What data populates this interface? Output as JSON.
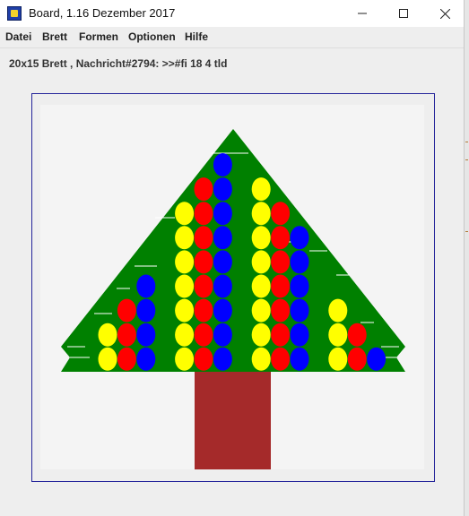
{
  "window": {
    "title": "Board, 1.16 Dezember 2017",
    "controls": {
      "minimize_icon": "minimize-icon",
      "maximize_icon": "maximize-icon",
      "close_icon": "close-icon"
    }
  },
  "menu": {
    "items": [
      {
        "label": "Datei"
      },
      {
        "label": "Brett"
      },
      {
        "label": "Formen"
      },
      {
        "label": "Optionen"
      },
      {
        "label": "Hilfe"
      }
    ]
  },
  "status": {
    "text": "20x15 Brett , Nachricht#2794: >>#fi 18 4 tld"
  },
  "board": {
    "columns": 20,
    "rows": 15,
    "colors": {
      "background": "#f4f4f4",
      "tree": "#008000",
      "trunk": "#a52a2a",
      "yellow": "#ffff00",
      "red": "#ff0000",
      "blue": "#0000ff",
      "garland": "#ffffff"
    },
    "ornaments": [
      {
        "col": 3,
        "row": 9,
        "color": "yellow"
      },
      {
        "col": 3,
        "row": 10,
        "color": "yellow"
      },
      {
        "col": 4,
        "row": 8,
        "color": "red"
      },
      {
        "col": 4,
        "row": 9,
        "color": "red"
      },
      {
        "col": 4,
        "row": 10,
        "color": "red"
      },
      {
        "col": 5,
        "row": 7,
        "color": "blue"
      },
      {
        "col": 5,
        "row": 8,
        "color": "blue"
      },
      {
        "col": 5,
        "row": 9,
        "color": "blue"
      },
      {
        "col": 5,
        "row": 10,
        "color": "blue"
      },
      {
        "col": 7,
        "row": 4,
        "color": "yellow"
      },
      {
        "col": 7,
        "row": 5,
        "color": "yellow"
      },
      {
        "col": 7,
        "row": 6,
        "color": "yellow"
      },
      {
        "col": 7,
        "row": 7,
        "color": "yellow"
      },
      {
        "col": 7,
        "row": 8,
        "color": "yellow"
      },
      {
        "col": 7,
        "row": 9,
        "color": "yellow"
      },
      {
        "col": 7,
        "row": 10,
        "color": "yellow"
      },
      {
        "col": 8,
        "row": 3,
        "color": "red"
      },
      {
        "col": 8,
        "row": 4,
        "color": "red"
      },
      {
        "col": 8,
        "row": 5,
        "color": "red"
      },
      {
        "col": 8,
        "row": 6,
        "color": "red"
      },
      {
        "col": 8,
        "row": 7,
        "color": "red"
      },
      {
        "col": 8,
        "row": 8,
        "color": "red"
      },
      {
        "col": 8,
        "row": 9,
        "color": "red"
      },
      {
        "col": 8,
        "row": 10,
        "color": "red"
      },
      {
        "col": 9,
        "row": 2,
        "color": "blue"
      },
      {
        "col": 9,
        "row": 3,
        "color": "blue"
      },
      {
        "col": 9,
        "row": 4,
        "color": "blue"
      },
      {
        "col": 9,
        "row": 5,
        "color": "blue"
      },
      {
        "col": 9,
        "row": 6,
        "color": "blue"
      },
      {
        "col": 9,
        "row": 7,
        "color": "blue"
      },
      {
        "col": 9,
        "row": 8,
        "color": "blue"
      },
      {
        "col": 9,
        "row": 9,
        "color": "blue"
      },
      {
        "col": 9,
        "row": 10,
        "color": "blue"
      },
      {
        "col": 11,
        "row": 3,
        "color": "yellow"
      },
      {
        "col": 11,
        "row": 4,
        "color": "yellow"
      },
      {
        "col": 11,
        "row": 5,
        "color": "yellow"
      },
      {
        "col": 11,
        "row": 6,
        "color": "yellow"
      },
      {
        "col": 11,
        "row": 7,
        "color": "yellow"
      },
      {
        "col": 11,
        "row": 8,
        "color": "yellow"
      },
      {
        "col": 11,
        "row": 9,
        "color": "yellow"
      },
      {
        "col": 11,
        "row": 10,
        "color": "yellow"
      },
      {
        "col": 12,
        "row": 4,
        "color": "red"
      },
      {
        "col": 12,
        "row": 5,
        "color": "red"
      },
      {
        "col": 12,
        "row": 6,
        "color": "red"
      },
      {
        "col": 12,
        "row": 7,
        "color": "red"
      },
      {
        "col": 12,
        "row": 8,
        "color": "red"
      },
      {
        "col": 12,
        "row": 9,
        "color": "red"
      },
      {
        "col": 12,
        "row": 10,
        "color": "red"
      },
      {
        "col": 13,
        "row": 5,
        "color": "blue"
      },
      {
        "col": 13,
        "row": 6,
        "color": "blue"
      },
      {
        "col": 13,
        "row": 7,
        "color": "blue"
      },
      {
        "col": 13,
        "row": 8,
        "color": "blue"
      },
      {
        "col": 13,
        "row": 9,
        "color": "blue"
      },
      {
        "col": 13,
        "row": 10,
        "color": "blue"
      },
      {
        "col": 15,
        "row": 8,
        "color": "yellow"
      },
      {
        "col": 15,
        "row": 9,
        "color": "yellow"
      },
      {
        "col": 15,
        "row": 10,
        "color": "yellow"
      },
      {
        "col": 16,
        "row": 9,
        "color": "red"
      },
      {
        "col": 16,
        "row": 10,
        "color": "red"
      },
      {
        "col": 17,
        "row": 10,
        "color": "blue"
      }
    ]
  }
}
